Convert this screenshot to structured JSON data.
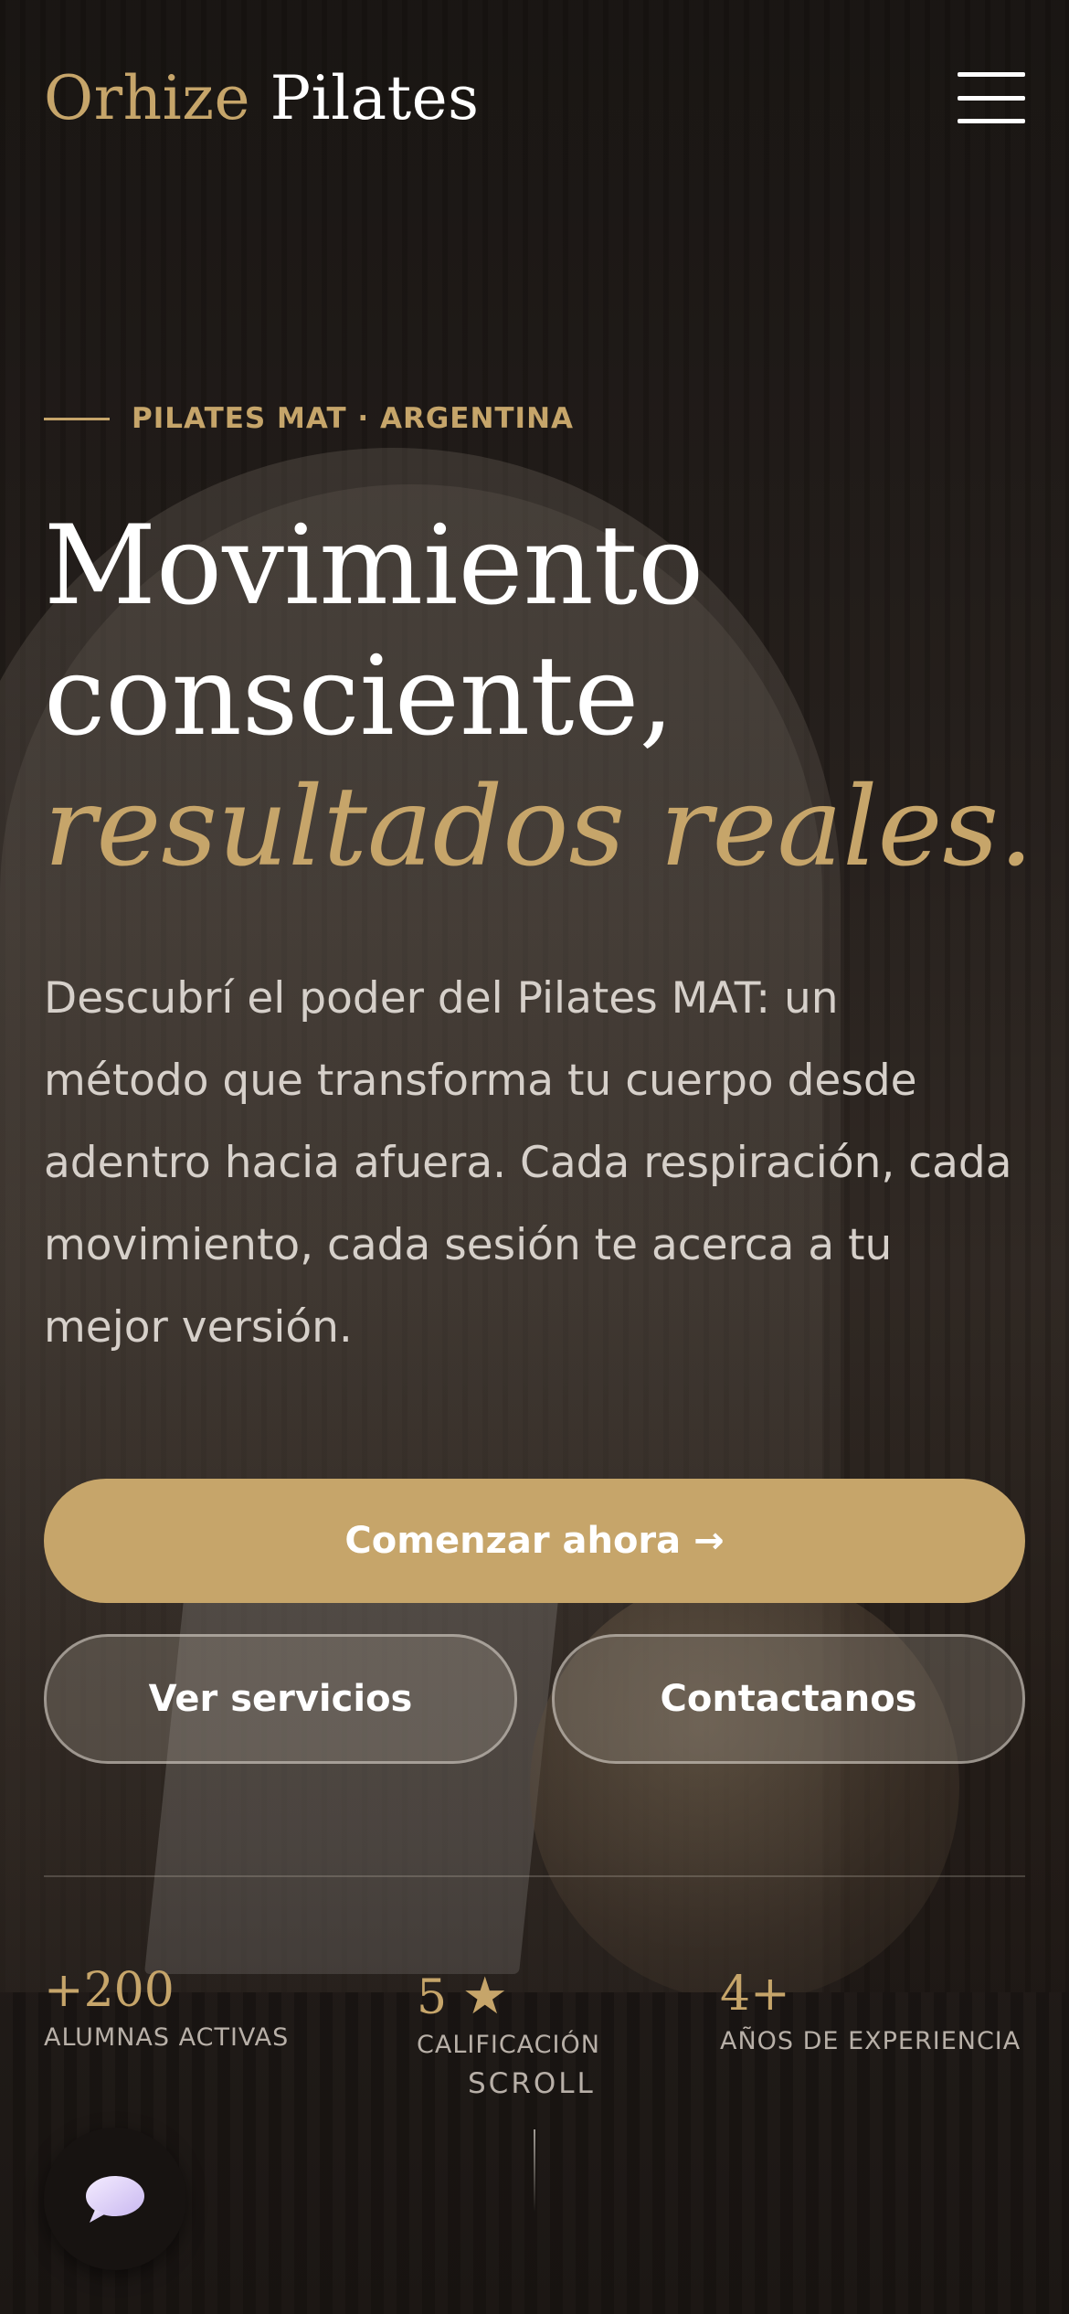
{
  "header": {
    "logo_part1": "Orhize",
    "logo_part2": "Pilates",
    "menu_icon": "hamburger-menu-icon"
  },
  "hero": {
    "eyebrow": "PILATES MAT · ARGENTINA",
    "headline_line1": "Movimiento",
    "headline_line2": "consciente,",
    "headline_accent": "resultados reales.",
    "description": "Descubrí el poder del Pilates MAT: un método que transforma tu cuerpo desde adentro hacia afuera. Cada respiración, cada movimiento, cada sesión te acerca a tu mejor versión."
  },
  "buttons": {
    "primary": "Comenzar ahora →",
    "services": "Ver servicios",
    "contact": "Contactanos"
  },
  "stats": [
    {
      "value": "+200",
      "label": "ALUMNAS ACTIVAS"
    },
    {
      "value": "5",
      "star": "★",
      "label": "CALIFICACIÓN"
    },
    {
      "value": "4+",
      "label": "AÑOS DE EXPERIENCIA"
    }
  ],
  "scroll_label": "SCROLL",
  "chat_icon": "chat-bubble-icon",
  "colors": {
    "accent": "#c6a56a",
    "text": "#ffffff",
    "muted": "#b8b0a8"
  }
}
